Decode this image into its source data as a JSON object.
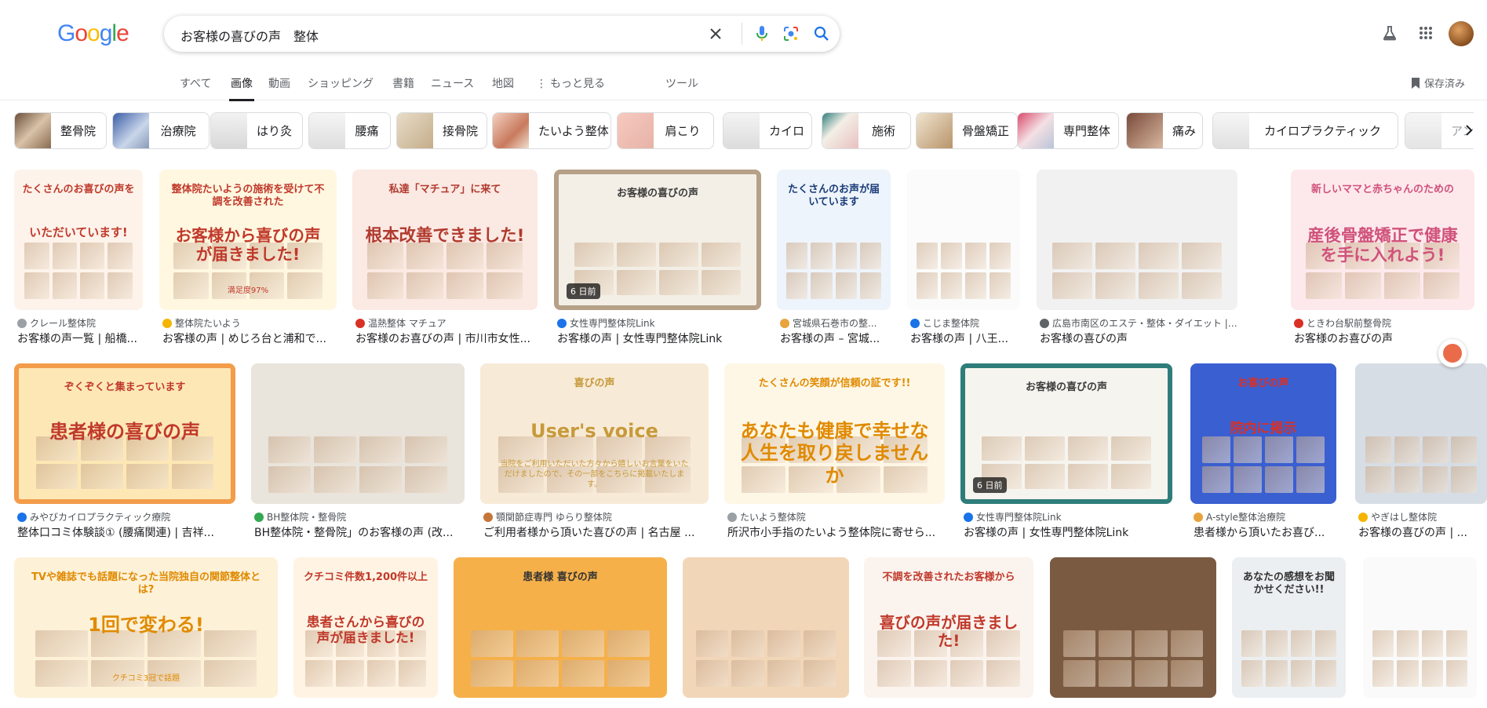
{
  "logo": {
    "text": "Google"
  },
  "search": {
    "query": "お客様の喜びの声　整体"
  },
  "tabs": [
    {
      "label": "すべて"
    },
    {
      "label": "画像"
    },
    {
      "label": "動画"
    },
    {
      "label": "ショッピング"
    },
    {
      "label": "書籍"
    },
    {
      "label": "ニュース"
    },
    {
      "label": "地図"
    },
    {
      "label": "もっと見る"
    },
    {
      "label": "ツール"
    }
  ],
  "saved_label": "保存済み",
  "chips": [
    {
      "label": "整骨院"
    },
    {
      "label": "治療院"
    },
    {
      "label": "はり灸"
    },
    {
      "label": "腰痛"
    },
    {
      "label": "接骨院"
    },
    {
      "label": "たいよう整体"
    },
    {
      "label": "肩こり"
    },
    {
      "label": "カイロ"
    },
    {
      "label": "施術"
    },
    {
      "label": "骨盤矯正"
    },
    {
      "label": "専門整体"
    },
    {
      "label": "痛み"
    },
    {
      "label": "カイロプラクティック"
    },
    {
      "label": "アン"
    }
  ],
  "results": [
    {
      "source": "クレール整体院",
      "title": "お客様の声一覧 | 船橋...",
      "img_text1": "たくさんのお喜びの声を",
      "img_text2": "いただいています!",
      "fav_color": "#9aa0a6",
      "bg": "#fdf3ea",
      "fg": "#c0392b"
    },
    {
      "source": "整体院たいよう",
      "title": "お客様の声 | めじろ台と浦和で...",
      "img_text1": "整体院たいようの施術を受けて不調を改善された",
      "img_text2": "お客様から喜びの声が届きました!",
      "img_text3": "満足度97%",
      "fav_color": "#f5b400",
      "bg": "#fff7e0",
      "fg": "#c0392b"
    },
    {
      "source": "温熱整体 マチュア",
      "title": "お客様のお喜びの声 | 市川市女性...",
      "img_text1": "私達「マチュア」に来て",
      "img_text2": "根本改善できました!",
      "fav_color": "#d93025",
      "bg": "#fbe9e3",
      "fg": "#b03a2e"
    },
    {
      "source": "女性専門整体院Link",
      "title": "お客様の声 | 女性専門整体院Link",
      "img_text1": "お客様の喜びの声",
      "img_text2": "",
      "age": "6 日前",
      "fav_color": "#1a73e8",
      "bg": "#f3efe6",
      "fg": "#3c3c3c",
      "border": "#b5a088"
    },
    {
      "source": "宮城県石巻市の整...",
      "title": "お客様の声 – 宮城...",
      "img_text1": "たくさんのお声が届いています",
      "img_text2": "",
      "fav_color": "#e8a33d",
      "bg": "#eef4fb",
      "fg": "#1a3c7a"
    },
    {
      "source": "こじま整体院",
      "title": "お客様の声 | 八王...",
      "img_text1": "",
      "img_text2": "",
      "fav_color": "#1a73e8",
      "bg": "#fbfbfb",
      "fg": "#333"
    },
    {
      "source": "広島市南区のエステ・整体・ダイエット | フェ...",
      "title": "お客様の喜びの声",
      "img_text1": "",
      "img_text2": "",
      "fav_color": "#5f6368",
      "bg": "#f1f1f1",
      "fg": "#333"
    },
    {
      "source": "ときわ台駅前整骨院",
      "title": "お客様のお喜びの声",
      "img_text1": "新しいママと赤ちゃんのための",
      "img_text2": "産後骨盤矯正で健康を手に入れよう!",
      "fav_color": "#d93025",
      "bg": "#fde9ec",
      "fg": "#d0527a"
    },
    {
      "source": "みやびカイロプラクティック療院",
      "title": "整体口コミ体験談① (腰痛関連) | 吉祥...",
      "img_text1": "ぞくぞくと集まっています",
      "img_text2": "患者様の喜びの声",
      "fav_color": "#1a73e8",
      "bg": "#fde8b5",
      "fg": "#c0392b",
      "border": "#f39c4a"
    },
    {
      "source": "BH整体院・整骨院",
      "title": "BH整体院・整骨院」のお客様の声 (改...",
      "img_text1": "",
      "img_text2": "",
      "fav_color": "#34a853",
      "bg": "#e9e4dc",
      "fg": "#333"
    },
    {
      "source": "顎関節症専門 ゆらり整体院",
      "title": "ご利用者様から頂いた喜びの声 | 名古屋 ...",
      "img_text1": "喜びの声",
      "img_text2": "User's voice",
      "img_text3": "当院をご利用いただいた方々から嬉しいお言葉をいただけましたので、その一部をこちらに掲載いたします。",
      "fav_color": "#c5763a",
      "bg": "#f7ead7",
      "fg": "#c79a3a"
    },
    {
      "source": "たいよう整体院",
      "title": "所沢市小手指のたいよう整体院に寄せら...",
      "img_text1": "たくさんの笑顔が信頼の証です!!",
      "img_text2": "あなたも健康で幸せな人生を取り戻しませんか",
      "fav_color": "#9aa0a6",
      "bg": "#fff7e6",
      "fg": "#e08a00"
    },
    {
      "source": "女性専門整体院Link",
      "title": "お客様の声 | 女性専門整体院Link",
      "img_text1": "お客様の喜びの声",
      "img_text2": "",
      "age": "6 日前",
      "fav_color": "#1a73e8",
      "bg": "#f6f4ef",
      "fg": "#3c3c3c",
      "border": "#2e7d7a"
    },
    {
      "source": "A-style整体治療院",
      "title": "患者様から頂いたお喜び...",
      "img_text1": "お喜びの声",
      "img_text2": "院内に掲示",
      "fav_color": "#e8a33d",
      "bg": "#3a5fd0",
      "fg": "#d93025"
    },
    {
      "source": "やぎはし整体院",
      "title": "お客様の喜びの声 | ...",
      "img_text1": "",
      "img_text2": "",
      "fav_color": "#f5b400",
      "bg": "#d7dde4",
      "fg": "#333"
    },
    {
      "source": "",
      "title": "",
      "img_text1": "TVや雑誌でも話題になった当院独自の関節整体とは?",
      "img_text2": "1回で変わる!",
      "img_text3": "クチコミ3冠で話題",
      "fav_color": "#9aa0a6",
      "bg": "#fdf1d8",
      "fg": "#e08a00"
    },
    {
      "source": "",
      "title": "",
      "img_text1": "クチコミ件数1,200件以上",
      "img_text2": "患者さんから喜びの声が届きました!",
      "fav_color": "#9aa0a6",
      "bg": "#fff3e3",
      "fg": "#c0392b"
    },
    {
      "source": "",
      "title": "",
      "img_text1": "患者様 喜びの声",
      "img_text2": "",
      "fav_color": "#9aa0a6",
      "bg": "#f6b04a",
      "fg": "#333"
    },
    {
      "source": "",
      "title": "",
      "img_text1": "",
      "img_text2": "",
      "fav_color": "#9aa0a6",
      "bg": "#f2d6b8",
      "fg": "#333"
    },
    {
      "source": "",
      "title": "",
      "img_text1": "不調を改善されたお客様から",
      "img_text2": "喜びの声が届きました!",
      "fav_color": "#9aa0a6",
      "bg": "#fbf3ee",
      "fg": "#c0392b"
    },
    {
      "source": "",
      "title": "",
      "img_text1": "",
      "img_text2": "",
      "fav_color": "#9aa0a6",
      "bg": "#7b5a42",
      "fg": "#fff"
    },
    {
      "source": "",
      "title": "",
      "img_text1": "あなたの感想をお聞かせください!!",
      "img_text2": "",
      "fav_color": "#9aa0a6",
      "bg": "#eceff1",
      "fg": "#333"
    },
    {
      "source": "",
      "title": "",
      "img_text1": "",
      "img_text2": "",
      "fav_color": "#9aa0a6",
      "bg": "#fafafa",
      "fg": "#333"
    }
  ]
}
